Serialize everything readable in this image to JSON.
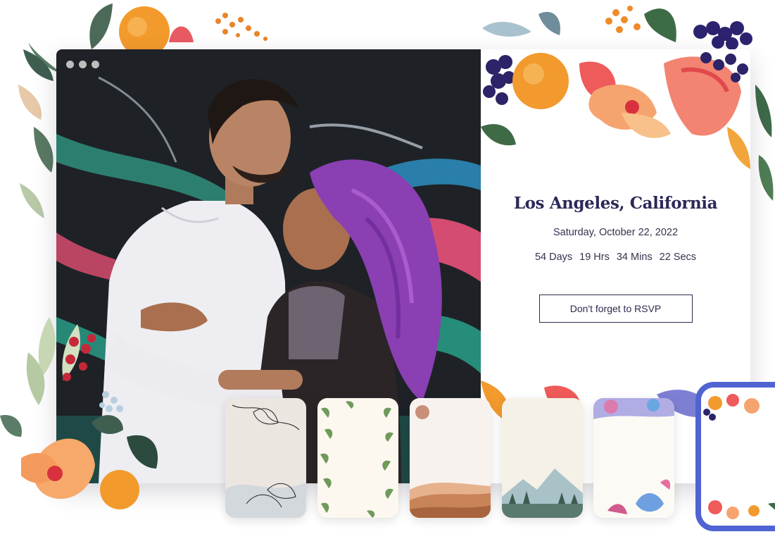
{
  "window": {
    "dots": [
      "window-dot-1",
      "window-dot-2",
      "window-dot-3"
    ]
  },
  "event": {
    "location": "Los Angeles, California",
    "date": "Saturday, October 22, 2022",
    "countdown": {
      "days": "54 Days",
      "hours": "19 Hrs",
      "minutes": "34 Mins",
      "seconds": "22 Secs"
    },
    "rsvp_label": "Don't forget to RSVP"
  },
  "templates": [
    {
      "id": "floral-line-art",
      "selected": false
    },
    {
      "id": "greenery-border",
      "selected": false
    },
    {
      "id": "desert-sunset",
      "selected": false
    },
    {
      "id": "mountain-landscape",
      "selected": false
    },
    {
      "id": "succulent-watercolor",
      "selected": false
    },
    {
      "id": "citrus-floral",
      "selected": true
    }
  ],
  "colors": {
    "title": "#2a2957",
    "accent_selected": "#4f63d2",
    "text": "#34334f"
  }
}
